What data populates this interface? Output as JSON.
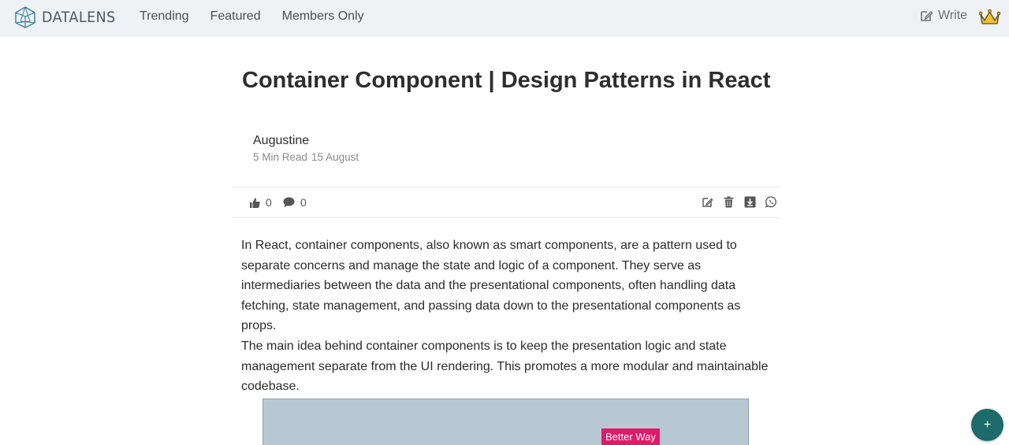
{
  "brand": {
    "name": "DATALENS"
  },
  "nav": {
    "items": [
      "Trending",
      "Featured",
      "Members Only"
    ]
  },
  "header_actions": {
    "write_label": "Write"
  },
  "article": {
    "title": "Container Component | Design Patterns in React",
    "author": "Augustine",
    "read_time": "5 Min Read",
    "date": "15 August",
    "likes": "0",
    "comments": "0",
    "paragraphs": [
      "In React, container components, also known as smart components, are a pattern used to separate concerns and manage the state and logic of a component. They serve as intermediaries between the data and the presentational components, often handling data fetching, state management, and passing data down to the presentational components as props.",
      "The main idea behind container components is to keep the presentation logic and state management separate from the UI rendering. This promotes a more modular and maintainable codebase."
    ],
    "figure_label": "Better Way"
  },
  "fab": {
    "label": "+"
  },
  "icons": {
    "logo": "network-polygon-icon",
    "write": "edit-icon",
    "premium": "crown-icon",
    "like": "thumbs-up-icon",
    "comment": "comment-icon",
    "edit": "edit-icon",
    "delete": "trash-icon",
    "download": "download-icon",
    "share": "whatsapp-icon"
  },
  "colors": {
    "topbar": "#eef2f5",
    "fab": "#1f6b6b",
    "figure_label": "#e0196a",
    "crown": "#f2c230"
  }
}
